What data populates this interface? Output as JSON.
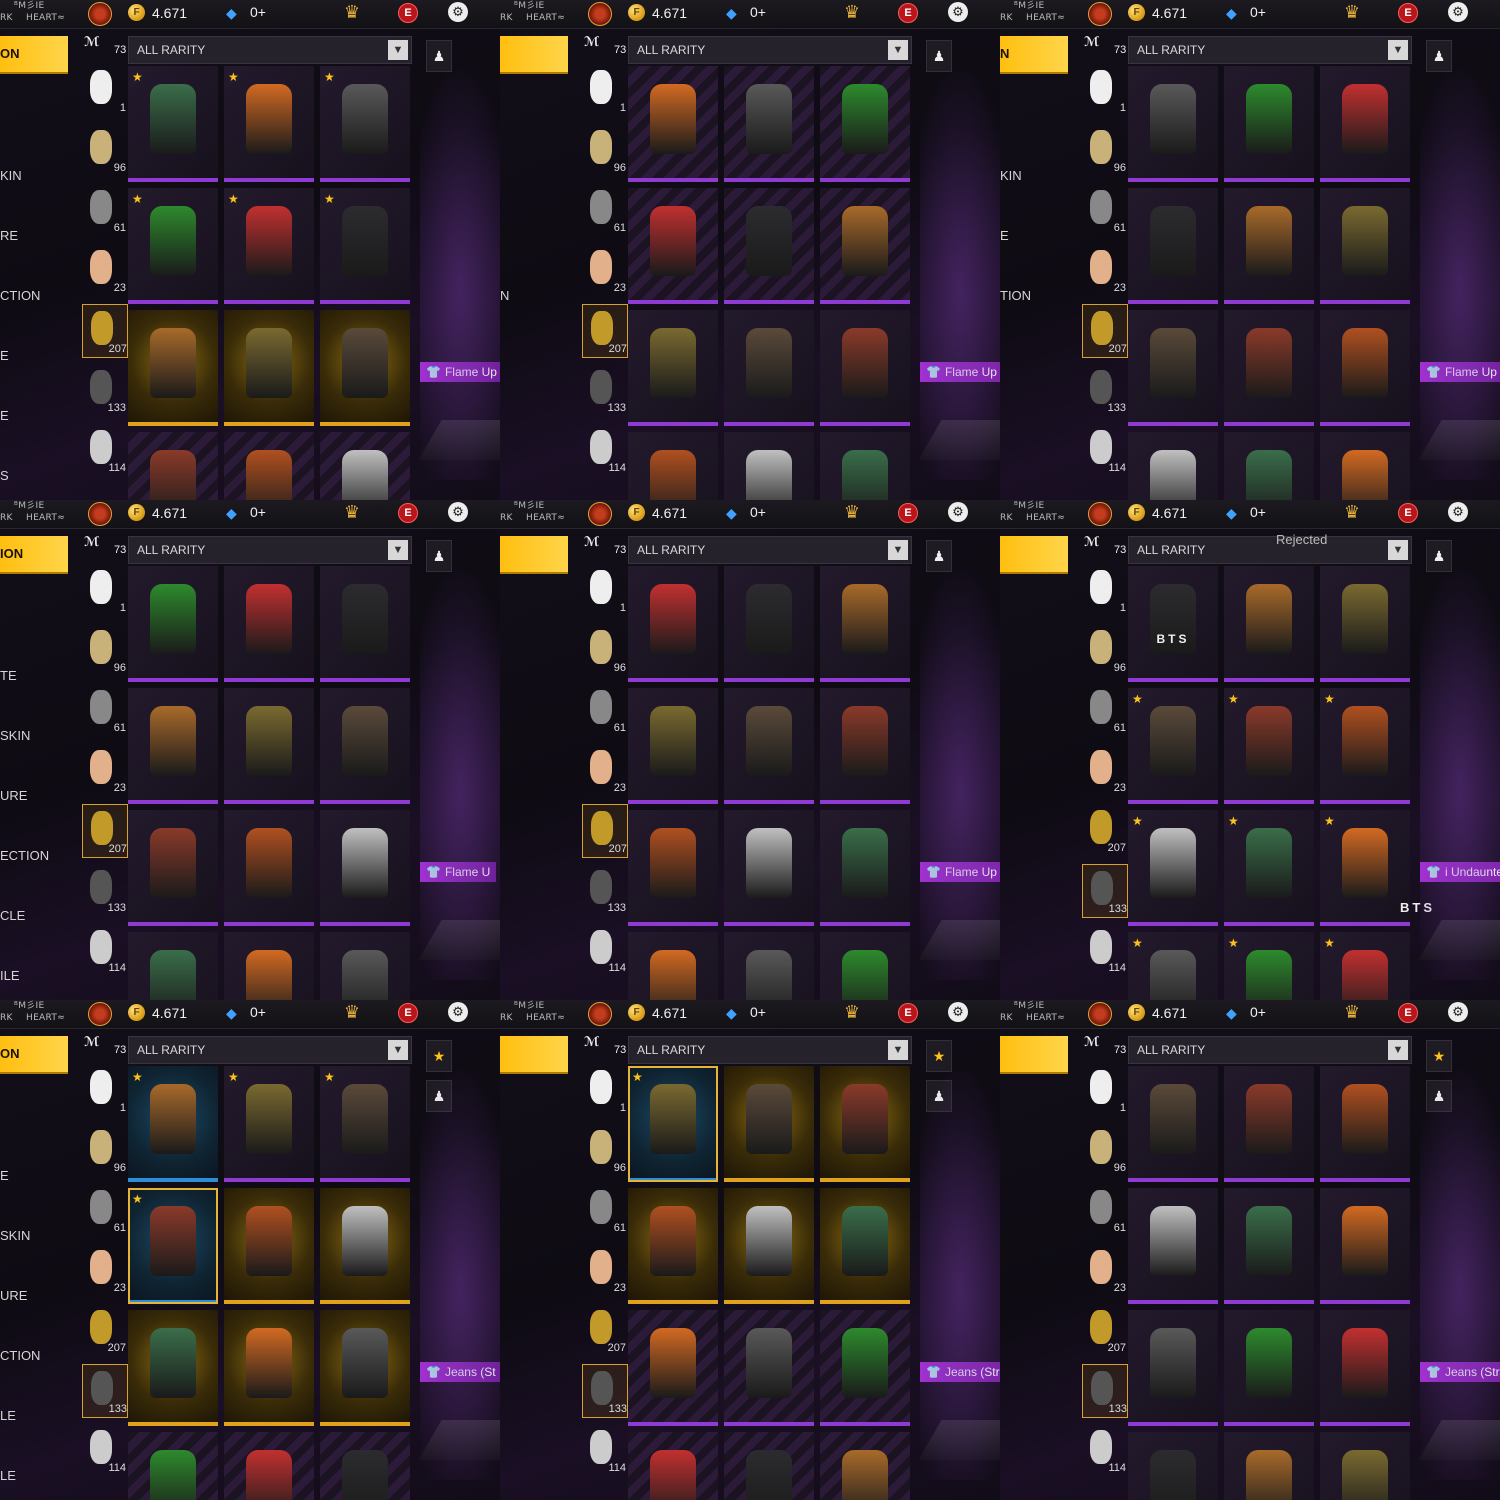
{
  "header": {
    "coins": "4.671",
    "diamonds": "0+",
    "coin_icon": "F",
    "diamond_icon": "◆",
    "rank_icon": "crown-icon",
    "event_badge": "E",
    "settings_icon": "⚙",
    "player_name_top": "ᴮM彡IE",
    "player_left": "RK",
    "player_right": "HEART≈"
  },
  "menu": {
    "active_label": "ON",
    "items": [
      "KIN",
      "RE",
      "CTION",
      "E",
      "E",
      "S"
    ]
  },
  "categories": [
    {
      "name": "hat",
      "count": "73"
    },
    {
      "name": "top-outfit",
      "count": "1"
    },
    {
      "name": "hair",
      "count": "96"
    },
    {
      "name": "mask",
      "count": "61"
    },
    {
      "name": "face",
      "count": "23"
    },
    {
      "name": "top",
      "count": "207"
    },
    {
      "name": "bottom",
      "count": "133"
    },
    {
      "name": "shoes",
      "count": "114"
    }
  ],
  "rarity_filter": "ALL RARITY",
  "panels": [
    {
      "menu_active": "ON",
      "menu": [
        "KIN",
        "RE",
        "CTION",
        "E",
        "E",
        "S"
      ],
      "selected_cat": 5,
      "tag": "Flame Up",
      "items": [
        {
          "star": true,
          "style": "plain"
        },
        {
          "star": true,
          "style": "plain"
        },
        {
          "star": true,
          "style": "plain"
        },
        {
          "star": true,
          "style": "plain"
        },
        {
          "star": true,
          "style": "plain"
        },
        {
          "star": true,
          "style": "plain"
        },
        {
          "star": false,
          "style": "gold"
        },
        {
          "star": false,
          "style": "gold"
        },
        {
          "star": false,
          "style": "gold"
        },
        {
          "star": false,
          "style": "stripe"
        },
        {
          "star": false,
          "style": "stripe"
        },
        {
          "star": false,
          "style": "stripe"
        }
      ]
    },
    {
      "menu_active": "",
      "menu": [
        "",
        "",
        "N",
        "",
        "",
        ""
      ],
      "selected_cat": 5,
      "tag": "Flame Up Jerse",
      "items": [
        {
          "star": false,
          "style": "stripe"
        },
        {
          "star": false,
          "style": "stripe"
        },
        {
          "star": false,
          "style": "stripe"
        },
        {
          "star": false,
          "style": "stripe"
        },
        {
          "star": false,
          "style": "stripe"
        },
        {
          "star": false,
          "style": "stripe"
        },
        {
          "star": false,
          "style": "plain"
        },
        {
          "star": false,
          "style": "plain"
        },
        {
          "star": false,
          "style": "plain"
        },
        {
          "star": false,
          "style": "plain"
        },
        {
          "star": false,
          "style": "plain"
        },
        {
          "star": false,
          "style": "plain"
        }
      ]
    },
    {
      "menu_active": "N",
      "menu": [
        "KIN",
        "E",
        "TION",
        "",
        "",
        ""
      ],
      "selected_cat": 5,
      "tag": "Flame Up J",
      "items": [
        {
          "star": false,
          "style": "plain"
        },
        {
          "star": false,
          "style": "plain"
        },
        {
          "star": false,
          "style": "plain"
        },
        {
          "star": false,
          "style": "plain"
        },
        {
          "star": false,
          "style": "plain"
        },
        {
          "star": false,
          "style": "plain"
        },
        {
          "star": false,
          "style": "plain"
        },
        {
          "star": false,
          "style": "plain"
        },
        {
          "star": false,
          "style": "plain"
        },
        {
          "star": false,
          "style": "plain"
        },
        {
          "star": false,
          "style": "plain"
        },
        {
          "star": false,
          "style": "plain"
        }
      ]
    },
    {
      "menu_active": "ION",
      "menu": [
        "TE",
        "SKIN",
        "URE",
        "ECTION",
        "CLE",
        "ILE"
      ],
      "selected_cat": 5,
      "tag": "Flame U",
      "items": [
        {
          "star": false,
          "style": "plain"
        },
        {
          "star": false,
          "style": "plain"
        },
        {
          "star": false,
          "style": "plain"
        },
        {
          "star": false,
          "style": "plain"
        },
        {
          "star": false,
          "style": "plain"
        },
        {
          "star": false,
          "style": "plain"
        },
        {
          "star": false,
          "style": "plain"
        },
        {
          "star": false,
          "style": "plain"
        },
        {
          "star": false,
          "style": "plain"
        },
        {
          "star": false,
          "style": "plain"
        },
        {
          "star": false,
          "style": "plain"
        },
        {
          "star": false,
          "style": "plain"
        }
      ]
    },
    {
      "menu_active": "",
      "menu": [
        "",
        "",
        "",
        "",
        "",
        ""
      ],
      "selected_cat": 5,
      "tag": "Flame Up Jersey",
      "items": [
        {
          "star": false,
          "style": "plain"
        },
        {
          "star": false,
          "style": "plain"
        },
        {
          "star": false,
          "style": "plain"
        },
        {
          "star": false,
          "style": "plain"
        },
        {
          "star": false,
          "style": "plain"
        },
        {
          "star": false,
          "style": "plain"
        },
        {
          "star": false,
          "style": "plain"
        },
        {
          "star": false,
          "style": "plain"
        },
        {
          "star": false,
          "style": "plain"
        },
        {
          "star": false,
          "style": "plain"
        },
        {
          "star": false,
          "style": "plain"
        },
        {
          "star": false,
          "style": "plain"
        }
      ]
    },
    {
      "menu_active": "",
      "menu": [
        "",
        "",
        "",
        "",
        "",
        ""
      ],
      "selected_cat": 6,
      "tag": "i Undaunted (Botto",
      "extra": "BTS",
      "rejected": "Rejected",
      "items": [
        {
          "star": false,
          "style": "plain",
          "label": "BTS"
        },
        {
          "star": false,
          "style": "plain"
        },
        {
          "star": false,
          "style": "plain"
        },
        {
          "star": true,
          "style": "plain"
        },
        {
          "star": true,
          "style": "plain"
        },
        {
          "star": true,
          "style": "plain"
        },
        {
          "star": true,
          "style": "plain"
        },
        {
          "star": true,
          "style": "plain"
        },
        {
          "star": true,
          "style": "plain"
        },
        {
          "star": true,
          "style": "plain"
        },
        {
          "star": true,
          "style": "plain"
        },
        {
          "star": true,
          "style": "plain"
        }
      ]
    },
    {
      "menu_active": "ON",
      "menu": [
        "E",
        "SKIN",
        "URE",
        "CTION",
        "LE",
        "LE"
      ],
      "selected_cat": 6,
      "tag": "Jeans (St",
      "items": [
        {
          "star": true,
          "style": "blue"
        },
        {
          "star": true,
          "style": "plain"
        },
        {
          "star": true,
          "style": "plain"
        },
        {
          "star": true,
          "style": "blue",
          "sel": true
        },
        {
          "star": false,
          "style": "gold"
        },
        {
          "star": false,
          "style": "gold"
        },
        {
          "star": false,
          "style": "gold"
        },
        {
          "star": false,
          "style": "gold"
        },
        {
          "star": false,
          "style": "gold"
        },
        {
          "star": false,
          "style": "stripe"
        },
        {
          "star": false,
          "style": "stripe"
        },
        {
          "star": false,
          "style": "stripe"
        }
      ]
    },
    {
      "menu_active": "",
      "menu": [
        "",
        "",
        "",
        "",
        "",
        ""
      ],
      "selected_cat": 6,
      "tag": "Jeans (Stripe)",
      "items": [
        {
          "star": true,
          "style": "blue",
          "sel": true
        },
        {
          "star": false,
          "style": "gold"
        },
        {
          "star": false,
          "style": "gold"
        },
        {
          "star": false,
          "style": "gold"
        },
        {
          "star": false,
          "style": "gold"
        },
        {
          "star": false,
          "style": "gold"
        },
        {
          "star": false,
          "style": "stripe"
        },
        {
          "star": false,
          "style": "stripe"
        },
        {
          "star": false,
          "style": "stripe"
        },
        {
          "star": false,
          "style": "stripe"
        },
        {
          "star": false,
          "style": "stripe"
        },
        {
          "star": false,
          "style": "stripe"
        }
      ]
    },
    {
      "menu_active": "",
      "menu": [
        "",
        "",
        "",
        "",
        "",
        ""
      ],
      "selected_cat": 6,
      "tag": "Jeans (Stripe)",
      "items": [
        {
          "star": false,
          "style": "plain"
        },
        {
          "star": false,
          "style": "plain"
        },
        {
          "star": false,
          "style": "plain"
        },
        {
          "star": false,
          "style": "plain"
        },
        {
          "star": false,
          "style": "plain"
        },
        {
          "star": false,
          "style": "plain"
        },
        {
          "star": false,
          "style": "plain"
        },
        {
          "star": false,
          "style": "plain"
        },
        {
          "star": false,
          "style": "plain"
        },
        {
          "star": false,
          "style": "plain"
        },
        {
          "star": false,
          "style": "plain"
        },
        {
          "star": false,
          "style": "plain"
        }
      ]
    }
  ],
  "colors": {
    "accent": "#ffc21a",
    "epic_purple": "#8e3ad3",
    "legend_gold": "#e0a21a",
    "rare_blue": "#2c8ed6"
  }
}
